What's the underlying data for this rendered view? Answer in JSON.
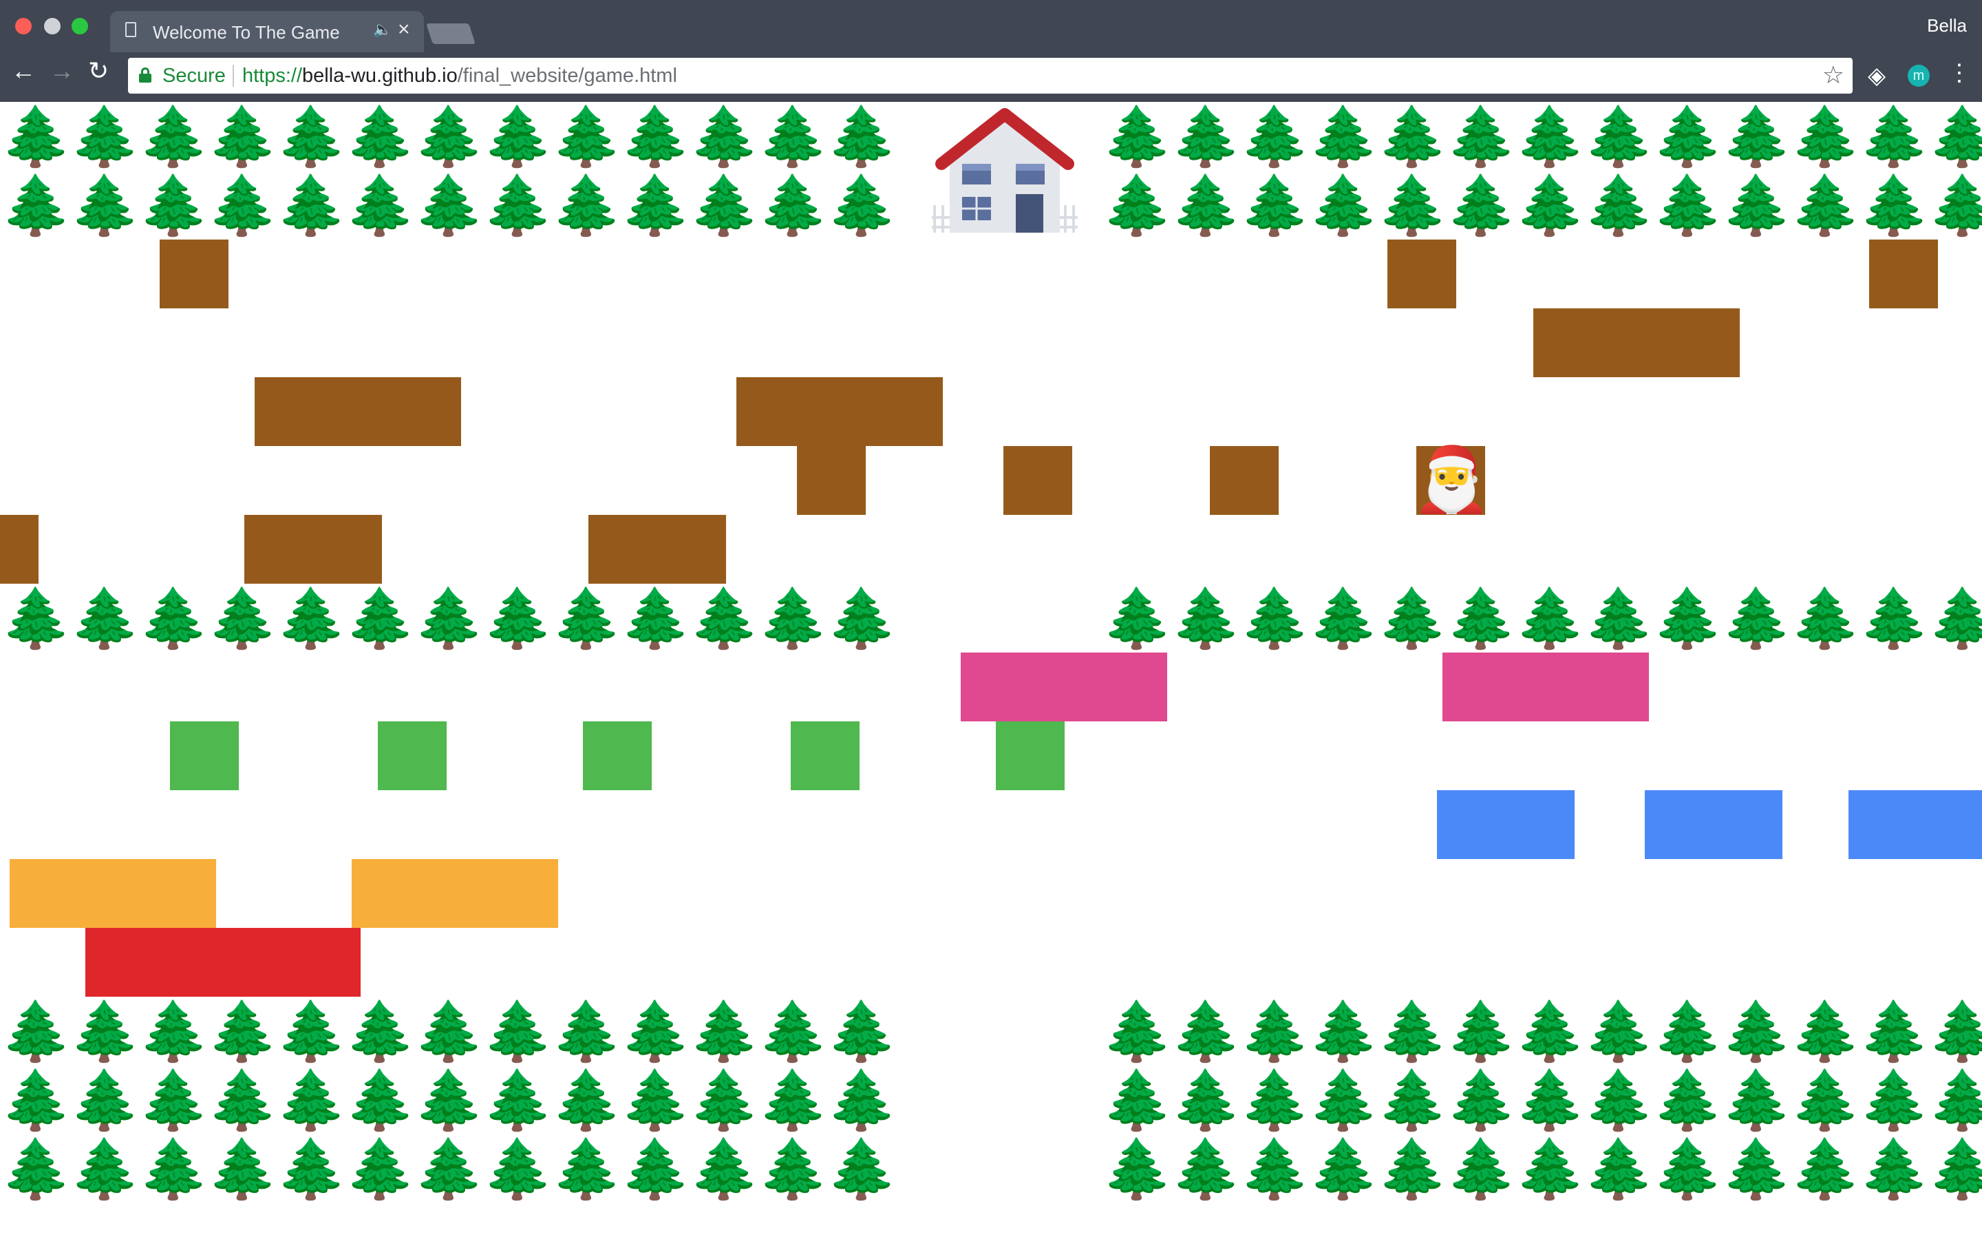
{
  "browser": {
    "tab_title": "Welcome To The Game",
    "profile_name": "Bella",
    "secure_label": "Secure",
    "url_scheme": "https://",
    "url_host": "bella-wu.github.io",
    "url_path": "/final_website/game.html",
    "icons": [
      "document-icon",
      "speaker-icon",
      "close-icon",
      "back-icon",
      "forward-icon",
      "reload-icon",
      "lock-icon",
      "star-icon",
      "gem-extension-icon",
      "m-extension-icon",
      "menu-icon"
    ]
  },
  "game": {
    "grid": {
      "columns": 29,
      "rows": 16
    },
    "tree_glyph": "🌲",
    "santa_glyph": "🎅",
    "colors": {
      "wood": "#955a1b",
      "pink": "#e0488f",
      "green": "#4fb84e",
      "blue": "#4b89f8",
      "orange": "#f8ae3b",
      "red": "#df262b"
    }
  }
}
